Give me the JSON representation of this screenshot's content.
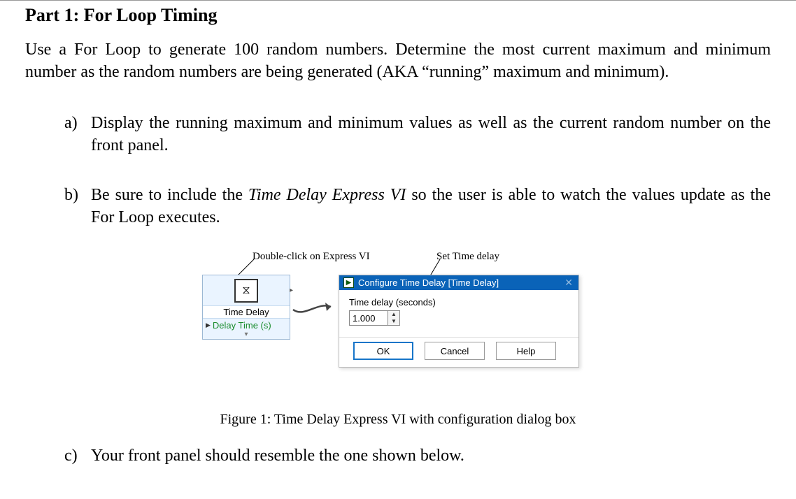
{
  "section_title": "Part 1: For Loop Timing",
  "intro": "Use a For Loop to generate 100 random numbers. Determine the most current maximum and minimum number as the random numbers are being generated (AKA “running” maximum and minimum).",
  "items": {
    "a": {
      "letter": "a)",
      "text": "Display the running maximum and minimum values as well as the current random number on the front panel."
    },
    "b": {
      "letter": "b)",
      "text_pre": "Be sure to include the ",
      "italic": "Time Delay Express VI",
      "text_post": " so the user is able to watch the values update as the For Loop executes."
    },
    "c": {
      "letter": "c)",
      "text": "Your front panel should resemble the one shown below."
    }
  },
  "figure": {
    "hw_left": "Double-click on Express VI",
    "hw_right": "Set Time delay",
    "express": {
      "icon_glyph": "⧖",
      "name": "Time Delay",
      "param": "Delay Time (s)"
    },
    "dialog": {
      "title": "Configure Time Delay [Time Delay]",
      "field_label": "Time delay (seconds)",
      "value": "1.000",
      "ok": "OK",
      "cancel": "Cancel",
      "help": "Help"
    },
    "caption": "Figure 1: Time Delay Express VI with configuration dialog box"
  }
}
